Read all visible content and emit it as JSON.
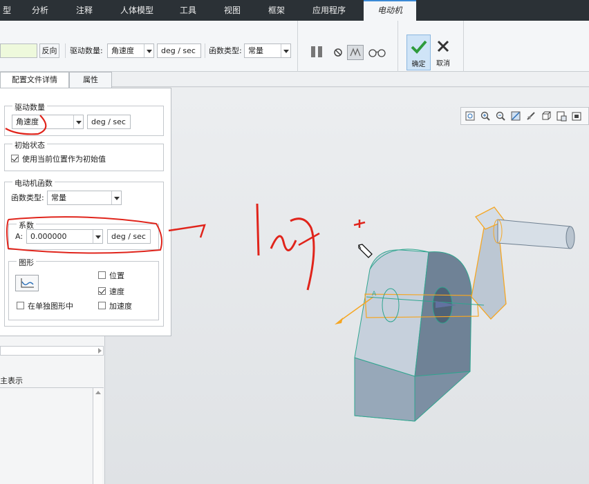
{
  "menu": {
    "tabs": [
      "型",
      "分析",
      "注释",
      "人体模型",
      "工具",
      "视图",
      "框架",
      "应用程序",
      "电动机"
    ],
    "active": "电动机"
  },
  "ribbon": {
    "reverse_btn": "反向",
    "drive_quantity_label": "驱动数量:",
    "drive_quantity_value": "角速度",
    "drive_unit": "deg / sec",
    "func_type_label": "函数类型:",
    "func_type_value": "常量",
    "ok_label": "确定",
    "cancel_label": "取消"
  },
  "subtabs": [
    "配置文件详情",
    "属性"
  ],
  "panel": {
    "drive_group_title": "驱动数量",
    "drive_value": "角速度",
    "drive_unit": "deg / sec",
    "init_group_title": "初始状态",
    "init_checkbox_label": "使用当前位置作为初始值",
    "init_checked": true,
    "func_group_title": "电动机函数",
    "func_type_label": "函数类型:",
    "func_type_value": "常量",
    "coef_group_title": "系数",
    "coef_label": "A:",
    "coef_value": "0.000000",
    "coef_unit": "deg / sec",
    "graph_group_title": "图形",
    "position_label": "位置",
    "position_checked": false,
    "velocity_label": "速度",
    "velocity_checked": true,
    "accel_label": "加速度",
    "accel_checked": false,
    "separate_label": "在单独图形中",
    "separate_checked": false
  },
  "tree": {
    "header": "主表示"
  },
  "handwriting": {
    "text": "1转"
  },
  "colors": {
    "menubar": "#2b3136",
    "accent": "#3a8ad6",
    "ink": "#e0241b",
    "model_face": "#c9d3df",
    "model_edge": "#2fa58f",
    "highlight": "#f5a623"
  }
}
